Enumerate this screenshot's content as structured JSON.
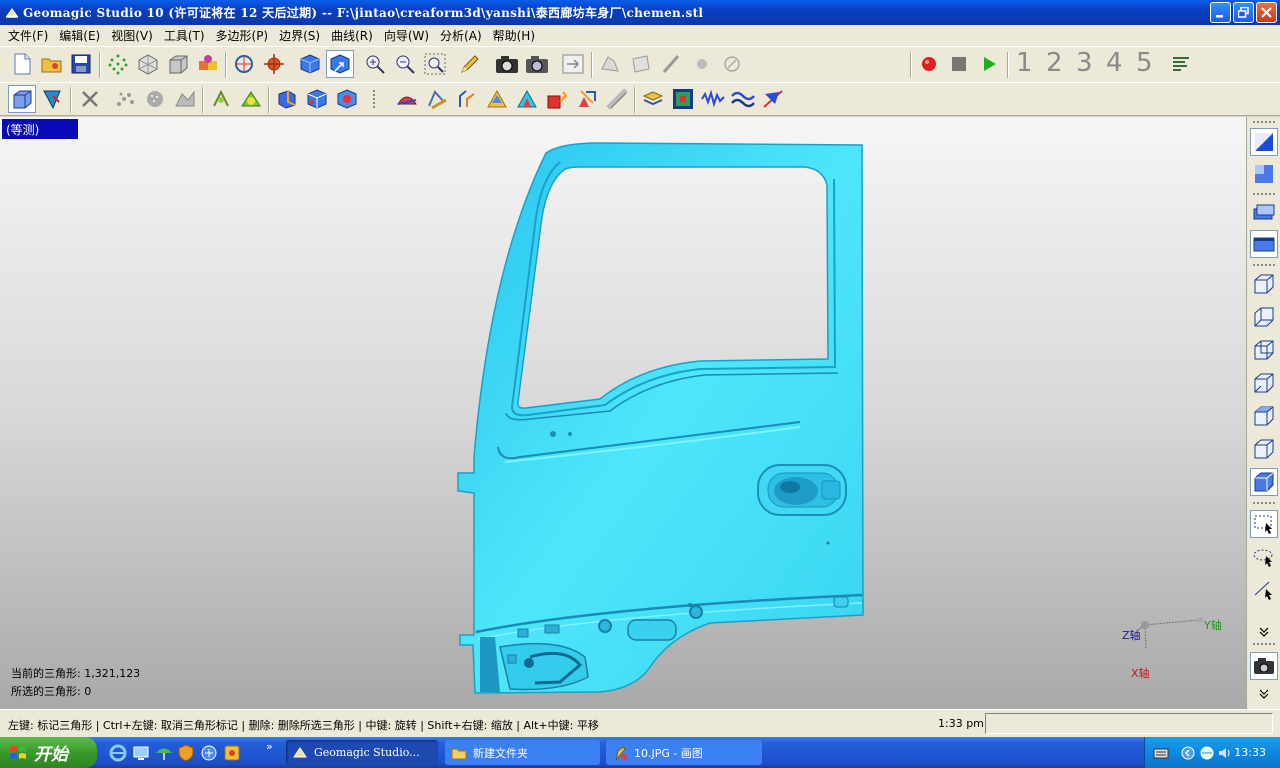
{
  "window": {
    "title": "Geomagic Studio 10 (许可证将在 12 天后过期) -- F:\\jintao\\creaform3d\\yanshi\\泰西廊坊车身厂\\chemen.stl"
  },
  "menu": [
    "文件(F)",
    "编辑(E)",
    "视图(V)",
    "工具(T)",
    "多边形(P)",
    "边界(S)",
    "曲线(R)",
    "向导(W)",
    "分析(A)",
    "帮助(H)"
  ],
  "macro_numbers": [
    "1",
    "2",
    "3",
    "4",
    "5"
  ],
  "viewport": {
    "view_label": "(等测)",
    "current_triangles_label": "当前的三角形: 1,321,123",
    "selected_triangles_label": "所选的三角形: 0",
    "axis": {
      "y": "Y轴",
      "z": "Z轴",
      "x": "X轴"
    }
  },
  "statusbar": {
    "hint": "左键: 标记三角形 | Ctrl+左键: 取消三角形标记 | 删除: 删除所选三角形 | 中键: 旋转 | Shift+右键: 缩放 | Alt+中键: 平移",
    "time": "1:33 pm"
  },
  "taskbar": {
    "start": "开始",
    "overflow": "»",
    "tasks": [
      {
        "label": "Geomagic Studio...",
        "icon": "geomagic-icon"
      },
      {
        "label": "新建文件夹",
        "icon": "folder-icon"
      },
      {
        "label": "10.JPG - 画图",
        "icon": "paint-icon"
      }
    ],
    "clock": "13:33"
  },
  "colors": {
    "model": "#3cd8f4",
    "model_edge": "#1aa0c8",
    "title_bar": "#0a4ad0",
    "view_label_bg": "#0a0ab8"
  }
}
